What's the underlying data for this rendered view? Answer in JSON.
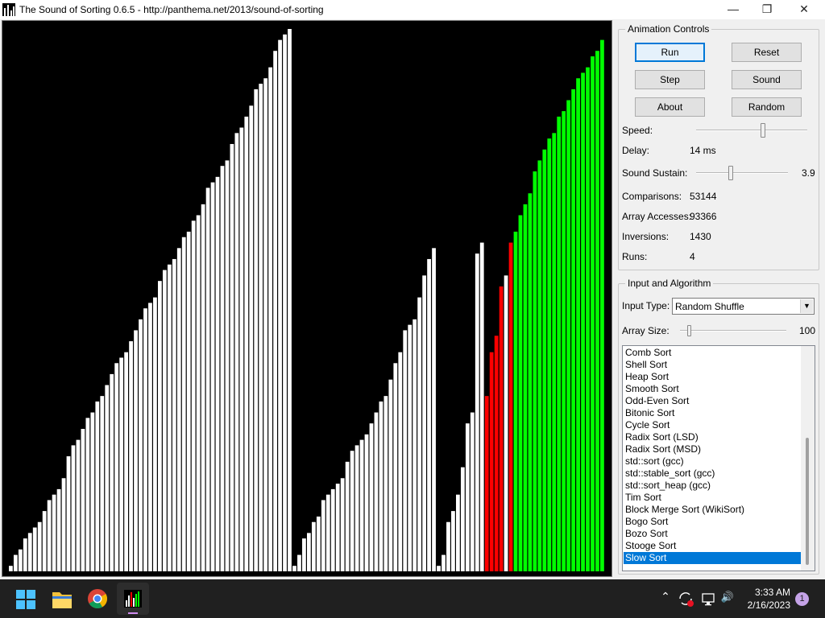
{
  "window": {
    "title": "The Sound of Sorting 0.6.5 - http://panthema.net/2013/sound-of-sorting",
    "minimize_glyph": "—",
    "maximize_glyph": "❐",
    "close_glyph": "✕"
  },
  "animation_controls": {
    "title": "Animation Controls",
    "buttons": {
      "run": "Run",
      "reset": "Reset",
      "step": "Step",
      "sound": "Sound",
      "about": "About",
      "random": "Random"
    },
    "speed_label": "Speed:",
    "delay_label": "Delay:",
    "delay_value": "14 ms",
    "sustain_label": "Sound Sustain:",
    "sustain_value": "3.9",
    "stats": [
      {
        "label": "Comparisons:",
        "value": "53144"
      },
      {
        "label": "Array Accesses:",
        "value": "93366"
      },
      {
        "label": "Inversions:",
        "value": "1430"
      },
      {
        "label": "Runs:",
        "value": "4"
      }
    ],
    "speed_level": 0.6,
    "sustain_level": 0.38
  },
  "input_algorithm": {
    "title": "Input and Algorithm",
    "input_type_label": "Input Type:",
    "input_type_value": "Random Shuffle",
    "array_size_label": "Array Size:",
    "array_size_value": "100",
    "array_size_level": 0.09,
    "algorithms": [
      "Comb Sort",
      "Shell Sort",
      "Heap Sort",
      "Smooth Sort",
      "Odd-Even Sort",
      "Bitonic Sort",
      "Cycle Sort",
      "Radix Sort (LSD)",
      "Radix Sort (MSD)",
      "std::sort (gcc)",
      "std::stable_sort (gcc)",
      "std::sort_heap (gcc)",
      "Tim Sort",
      "Block Merge Sort (WikiSort)",
      "Bogo Sort",
      "Bozo Sort",
      "Stooge Sort",
      "Slow Sort"
    ],
    "selected_algorithm": "Slow Sort"
  },
  "visualization": {
    "colors": {
      "normal": "#ffffff",
      "compare": "#ff0000",
      "sorted": "#00ff00",
      "background": "#000000"
    },
    "array": [
      1,
      3,
      4,
      6,
      7,
      8,
      9,
      11,
      13,
      14,
      15,
      17,
      21,
      23,
      24,
      26,
      28,
      29,
      31,
      32,
      34,
      36,
      38,
      39,
      40,
      42,
      44,
      46,
      48,
      49,
      50,
      53,
      55,
      56,
      57,
      59,
      61,
      62,
      64,
      65,
      67,
      70,
      71,
      72,
      74,
      75,
      78,
      80,
      81,
      83,
      85,
      88,
      89,
      90,
      92,
      95,
      97,
      98,
      99,
      1,
      3,
      6,
      7,
      9,
      10,
      13,
      14,
      15,
      16,
      17,
      20,
      22,
      23,
      24,
      25,
      27,
      29,
      31,
      32,
      35,
      38,
      40,
      44,
      45,
      46,
      50,
      54,
      57,
      59,
      1,
      3,
      9,
      11,
      14,
      19,
      27,
      29,
      58,
      60,
      32,
      40,
      43,
      52,
      54,
      60,
      62,
      65,
      67,
      69,
      73,
      75,
      77,
      79,
      80,
      83,
      84,
      86,
      88,
      90,
      91,
      92,
      94,
      95,
      97
    ],
    "states": [
      "n",
      "n",
      "n",
      "n",
      "n",
      "n",
      "n",
      "n",
      "n",
      "n",
      "n",
      "n",
      "n",
      "n",
      "n",
      "n",
      "n",
      "n",
      "n",
      "n",
      "n",
      "n",
      "n",
      "n",
      "n",
      "n",
      "n",
      "n",
      "n",
      "n",
      "n",
      "n",
      "n",
      "n",
      "n",
      "n",
      "n",
      "n",
      "n",
      "n",
      "n",
      "n",
      "n",
      "n",
      "n",
      "n",
      "n",
      "n",
      "n",
      "n",
      "n",
      "n",
      "n",
      "n",
      "n",
      "n",
      "n",
      "n",
      "n",
      "n",
      "n",
      "n",
      "n",
      "n",
      "n",
      "n",
      "n",
      "n",
      "n",
      "n",
      "n",
      "n",
      "n",
      "n",
      "n",
      "n",
      "n",
      "n",
      "n",
      "n",
      "n",
      "n",
      "n",
      "n",
      "n",
      "n",
      "n",
      "n",
      "n",
      "n",
      "n",
      "n",
      "n",
      "n",
      "n",
      "n",
      "n",
      "n",
      "n",
      "c",
      "c",
      "c",
      "c",
      "n",
      "c",
      "s",
      "s",
      "s",
      "s",
      "s",
      "s",
      "s",
      "s",
      "s",
      "s",
      "s",
      "s",
      "s",
      "s",
      "s",
      "s",
      "s",
      "s",
      "s"
    ],
    "max_value": 99
  },
  "taskbar": {
    "time": "3:33 AM",
    "date": "2/16/2023",
    "notification_count": "1",
    "chevron_glyph": "⌃",
    "speaker_glyph": "🔊"
  }
}
